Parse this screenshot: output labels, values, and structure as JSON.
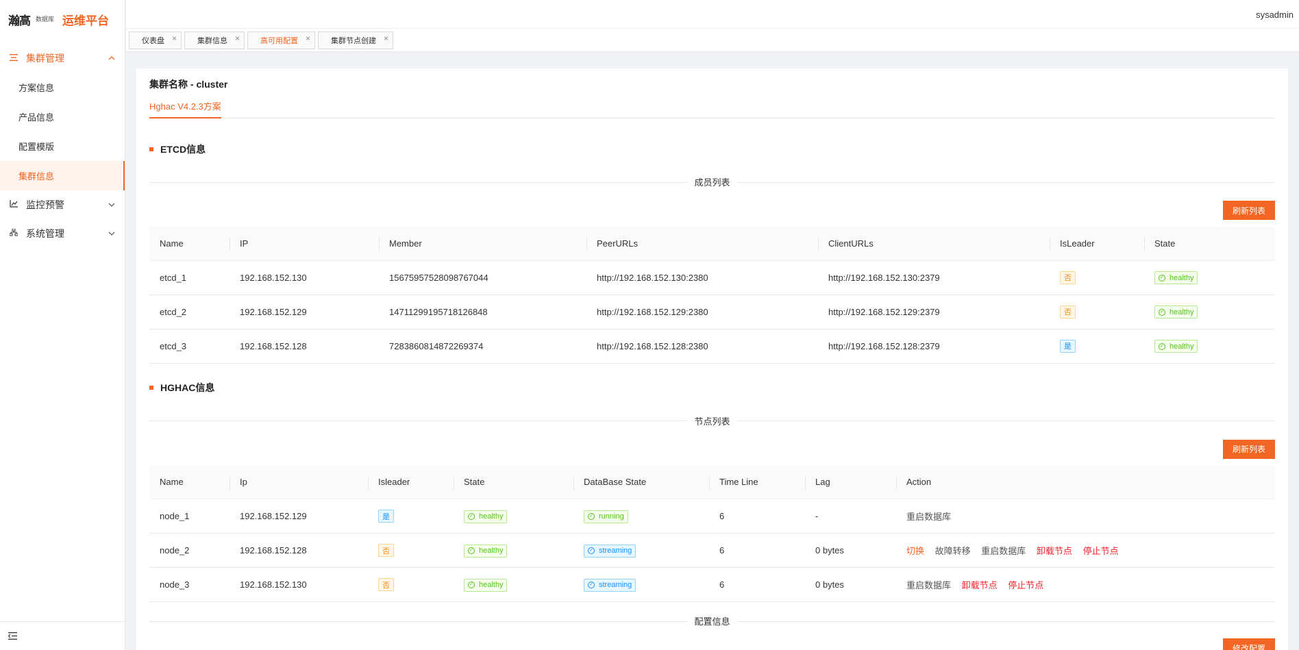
{
  "app": {
    "logo_text": "瀚高",
    "logo_sub": "数据库",
    "title": "运维平台"
  },
  "user": {
    "name": "sysadmin"
  },
  "sidebar": {
    "groups": [
      {
        "label": "集群管理",
        "icon": "list-icon",
        "expanded": true
      },
      {
        "label": "监控预警",
        "icon": "chart-icon",
        "expanded": false
      },
      {
        "label": "系统管理",
        "icon": "org-icon",
        "expanded": false
      }
    ],
    "sub_items": [
      "方案信息",
      "产品信息",
      "配置模版",
      "集群信息"
    ],
    "selected": "集群信息"
  },
  "tabs": [
    {
      "label": "仪表盘",
      "active": false
    },
    {
      "label": "集群信息",
      "active": false
    },
    {
      "label": "高可用配置",
      "active": true
    },
    {
      "label": "集群节点创建",
      "active": false
    }
  ],
  "page": {
    "cluster_title": "集群名称 - cluster",
    "scheme_tab": "Hghac V4.2.3方案"
  },
  "etcd": {
    "section_title": "ETCD信息",
    "divider": "成员列表",
    "refresh_label": "刷新列表",
    "columns": [
      "Name",
      "IP",
      "Member",
      "PeerURLs",
      "ClientURLs",
      "IsLeader",
      "State"
    ],
    "rows": [
      {
        "name": "etcd_1",
        "ip": "192.168.152.130",
        "member": "15675957528098767044",
        "peer": "http://192.168.152.130:2380",
        "client": "http://192.168.152.130:2379",
        "leader": "否",
        "state": "healthy"
      },
      {
        "name": "etcd_2",
        "ip": "192.168.152.129",
        "member": "14711299195718126848",
        "peer": "http://192.168.152.129:2380",
        "client": "http://192.168.152.129:2379",
        "leader": "否",
        "state": "healthy"
      },
      {
        "name": "etcd_3",
        "ip": "192.168.152.128",
        "member": "7283860814872269374",
        "peer": "http://192.168.152.128:2380",
        "client": "http://192.168.152.128:2379",
        "leader": "是",
        "state": "healthy"
      }
    ]
  },
  "hghac": {
    "section_title": "HGHAC信息",
    "divider": "节点列表",
    "refresh_label": "刷新列表",
    "columns": [
      "Name",
      "Ip",
      "Isleader",
      "State",
      "DataBase State",
      "Time Line",
      "Lag",
      "Action"
    ],
    "rows": [
      {
        "name": "node_1",
        "ip": "192.168.152.129",
        "leader": "是",
        "state": "healthy",
        "db_state": "running",
        "timeline": "6",
        "lag": "-",
        "actions": [
          {
            "label": "重启数据库",
            "tone": "gray"
          }
        ]
      },
      {
        "name": "node_2",
        "ip": "192.168.152.128",
        "leader": "否",
        "state": "healthy",
        "db_state": "streaming",
        "timeline": "6",
        "lag": "0 bytes",
        "actions": [
          {
            "label": "切换",
            "tone": "orange"
          },
          {
            "label": "故障转移",
            "tone": "gray"
          },
          {
            "label": "重启数据库",
            "tone": "gray"
          },
          {
            "label": "卸载节点",
            "tone": "red"
          },
          {
            "label": "停止节点",
            "tone": "red"
          }
        ]
      },
      {
        "name": "node_3",
        "ip": "192.168.152.130",
        "leader": "否",
        "state": "healthy",
        "db_state": "streaming",
        "timeline": "6",
        "lag": "0 bytes",
        "actions": [
          {
            "label": "重启数据库",
            "tone": "gray"
          },
          {
            "label": "卸载节点",
            "tone": "red"
          },
          {
            "label": "停止节点",
            "tone": "red"
          }
        ]
      }
    ]
  },
  "config": {
    "divider": "配置信息",
    "edit_label": "修改配置"
  },
  "colors": {
    "accent": "#f26522",
    "healthy": "#52c41a",
    "leader_yes": "#1890ff",
    "leader_no": "#fa8c16",
    "danger": "#f5222d"
  }
}
